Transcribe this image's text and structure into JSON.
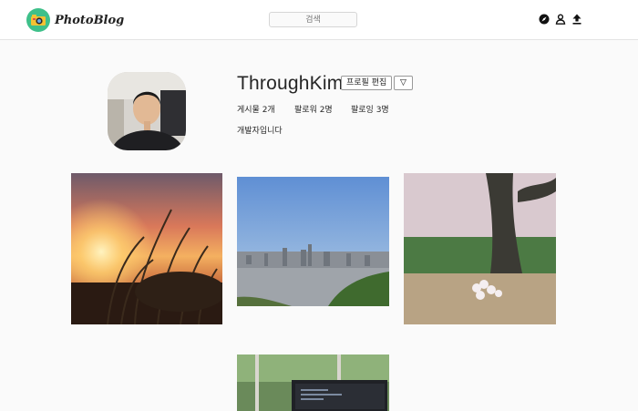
{
  "header": {
    "logo_text": "PhotoBlog",
    "search": {
      "placeholder": "검색"
    },
    "icons": [
      "compass-icon",
      "user-icon",
      "upload-icon"
    ]
  },
  "profile": {
    "username": "ThroughKim",
    "edit_label": "프로필 편집",
    "options_symbol": "▽",
    "stats": {
      "posts": "게시물 2개",
      "followers": "팔로워 2명",
      "following": "팔로잉 3명"
    },
    "bio": "개발자입니다"
  },
  "colors": {
    "accent": "#3ec08a",
    "header_bg": "#ffffff",
    "page_bg": "#fafafa"
  },
  "posts": [
    {
      "subject": "sunset-reeds"
    },
    {
      "subject": "city-skyline"
    },
    {
      "subject": "cherry-blossom"
    },
    {
      "subject": "laptop-by-window"
    }
  ]
}
